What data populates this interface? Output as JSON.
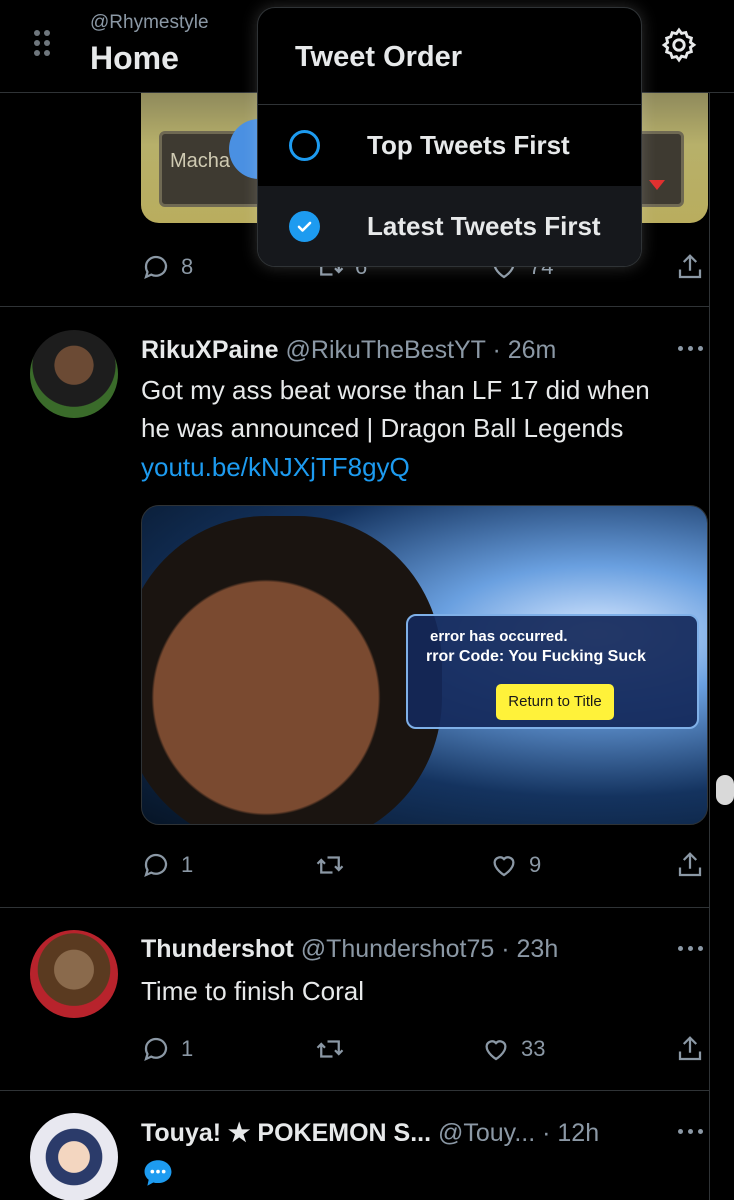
{
  "header": {
    "account_handle": "@Rhymestyle",
    "title": "Home"
  },
  "dropdown": {
    "title": "Tweet Order",
    "options": [
      {
        "label": "Top Tweets First",
        "selected": false
      },
      {
        "label": "Latest Tweets First",
        "selected": true
      }
    ]
  },
  "top_tweet": {
    "media_text": "Macha",
    "stats": {
      "replies": "8",
      "retweets": "6",
      "likes": "74"
    }
  },
  "tweets": [
    {
      "name": "RikuXPaine",
      "handle": "@RikuTheBestYT",
      "time": "· 26m",
      "text_lines": [
        "Got my ass beat worse than LF 17 did when",
        "he was announced | Dragon Ball Legends"
      ],
      "link": "youtu.be/kNJXjTF8gyQ",
      "media": {
        "line1": "error has occurred.",
        "line2_prefix": "rror Code:",
        "line2_code": "You Fucking Suck",
        "button": "Return to Title"
      },
      "stats": {
        "replies": "1",
        "retweets": "",
        "likes": "9"
      }
    },
    {
      "name": "Thundershot",
      "handle": "@Thundershot75",
      "time": "· 23h",
      "text": "Time to finish Coral",
      "stats": {
        "replies": "1",
        "retweets": "",
        "likes": "33"
      }
    },
    {
      "name": "Touya! ★ POKEMON S...",
      "handle": "@Touy...",
      "time": "· 12h"
    }
  ],
  "colors": {
    "accent": "#1d9bf0",
    "background": "#000000",
    "muted": "#8b98a5",
    "border": "#2f3336"
  },
  "icons": [
    "drag-handle-icon",
    "gear-icon",
    "reply-icon",
    "retweet-icon",
    "like-icon",
    "share-icon",
    "more-icon",
    "speech-bubble-icon"
  ]
}
